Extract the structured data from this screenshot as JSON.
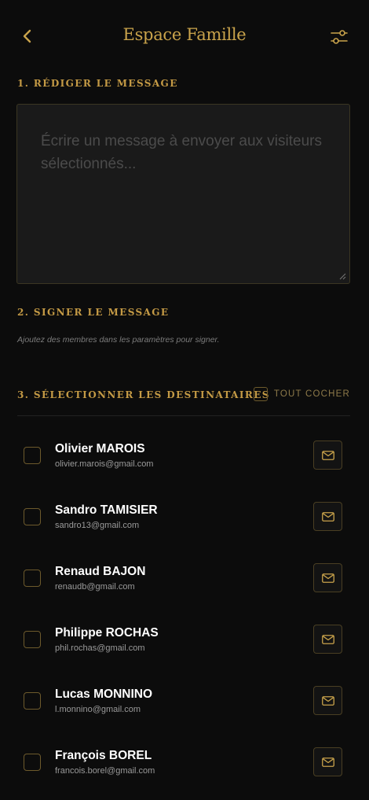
{
  "header": {
    "title": "Espace Famille"
  },
  "compose": {
    "section_label": "1. Rédiger le message",
    "placeholder": "Écrire un message à envoyer aux visiteurs sélectionnés..."
  },
  "sign": {
    "section_label": "2. Signer le message",
    "hint": "Ajoutez des membres dans les paramètres pour signer."
  },
  "recipients": {
    "section_label": "3. Sélectionner les destinataires",
    "check_all_label": "TOUT COCHER",
    "items": [
      {
        "name": "Olivier MAROIS",
        "email": "olivier.marois@gmail.com"
      },
      {
        "name": "Sandro TAMISIER",
        "email": "sandro13@gmail.com"
      },
      {
        "name": "Renaud BAJON",
        "email": "renaudb@gmail.com"
      },
      {
        "name": "Philippe ROCHAS",
        "email": "phil.rochas@gmail.com"
      },
      {
        "name": "Lucas MONNINO",
        "email": "l.monnino@gmail.com"
      },
      {
        "name": "François BOREL",
        "email": "francois.borel@gmail.com"
      }
    ]
  },
  "colors": {
    "accent": "#c9a34b",
    "background": "#0c0c0c"
  },
  "icons": {
    "back": "chevron-left-icon",
    "filter": "sliders-icon",
    "mail": "mail-icon"
  }
}
